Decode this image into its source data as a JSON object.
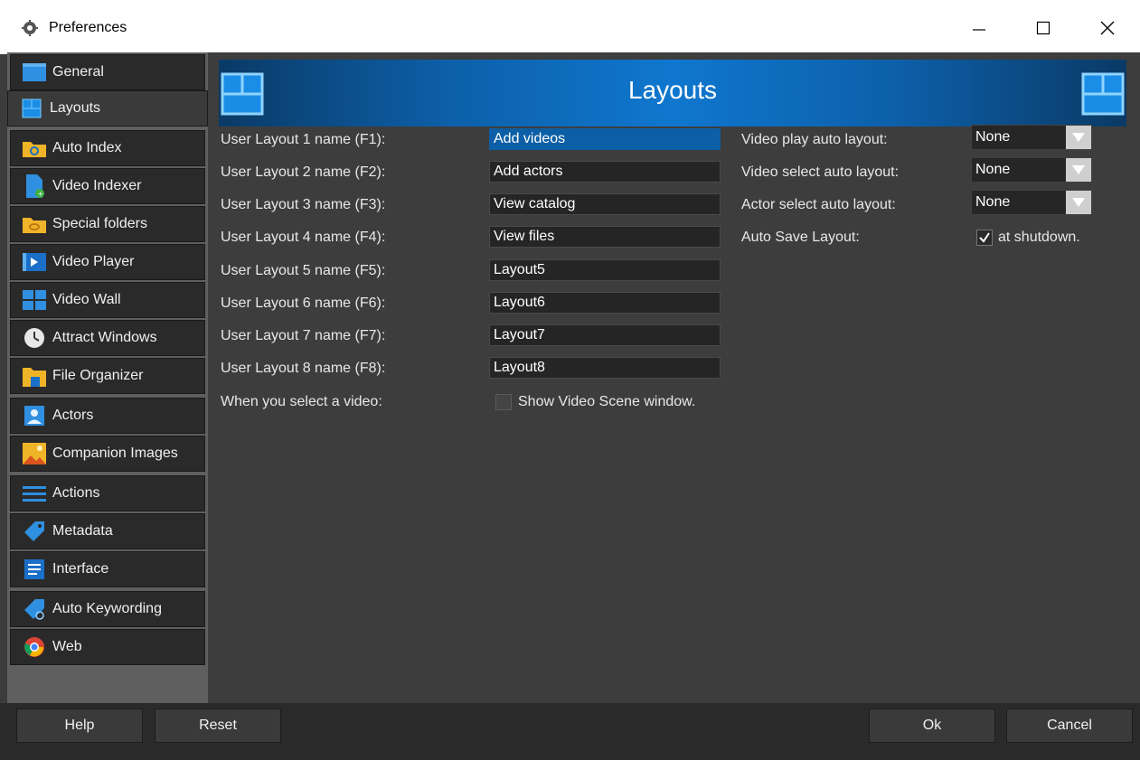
{
  "window": {
    "title": "Preferences",
    "icon": "gear-icon",
    "controls": {
      "minimize": "minimize-icon",
      "maximize": "maximize-icon",
      "close": "close-icon"
    }
  },
  "sidebar": {
    "items": [
      {
        "label": "General",
        "icon": "general-window-icon"
      },
      {
        "label": "Layouts",
        "icon": "layouts-icon",
        "selected": true
      },
      {
        "label": "Auto Index",
        "icon": "folder-refresh-icon"
      },
      {
        "label": "Video Indexer",
        "icon": "file-add-icon"
      },
      {
        "label": "Special folders",
        "icon": "folder-link-icon"
      },
      {
        "label": "Video Player",
        "icon": "video-player-icon"
      },
      {
        "label": "Video Wall",
        "icon": "video-wall-icon"
      },
      {
        "label": "Attract Windows",
        "icon": "clock-icon"
      },
      {
        "label": "File Organizer",
        "icon": "file-organizer-icon"
      },
      {
        "label": "Actors",
        "icon": "person-icon"
      },
      {
        "label": "Companion Images",
        "icon": "image-icon"
      },
      {
        "label": "Actions",
        "icon": "list-lines-icon"
      },
      {
        "label": "Metadata",
        "icon": "tag-icon"
      },
      {
        "label": "Interface",
        "icon": "interface-icon"
      },
      {
        "label": "Auto Keywording",
        "icon": "tag-refresh-icon"
      },
      {
        "label": "Web",
        "icon": "chrome-icon"
      }
    ]
  },
  "main": {
    "header_title": "Layouts",
    "layout_names": [
      {
        "label": "User Layout 1 name (F1):",
        "value": "Add videos",
        "focused": true
      },
      {
        "label": "User Layout 2 name (F2):",
        "value": "Add actors"
      },
      {
        "label": "User Layout 3 name (F3):",
        "value": "View catalog"
      },
      {
        "label": "User Layout 4 name (F4):",
        "value": "View files"
      },
      {
        "label": "User Layout 5 name (F5):",
        "value": "Layout5"
      },
      {
        "label": "User Layout 6 name (F6):",
        "value": "Layout6"
      },
      {
        "label": "User Layout 7 name (F7):",
        "value": "Layout7"
      },
      {
        "label": "User Layout 8 name (F8):",
        "value": "Layout8"
      }
    ],
    "select_video": {
      "label": "When you select a video:",
      "checkbox_label": "Show Video Scene window.",
      "checked": false
    },
    "auto_layouts": [
      {
        "label": "Video play auto layout:",
        "value": "None"
      },
      {
        "label": "Video select auto layout:",
        "value": "None"
      },
      {
        "label": "Actor select auto layout:",
        "value": "None"
      }
    ],
    "auto_save": {
      "label": "Auto Save Layout:",
      "checkbox_label": "at shutdown.",
      "checked": true
    }
  },
  "footer": {
    "help": "Help",
    "reset": "Reset",
    "ok": "Ok",
    "cancel": "Cancel"
  },
  "colors": {
    "accent": "#0f77cf",
    "background": "#3d3d3d",
    "sidebar_item": "#2a2a2a"
  }
}
